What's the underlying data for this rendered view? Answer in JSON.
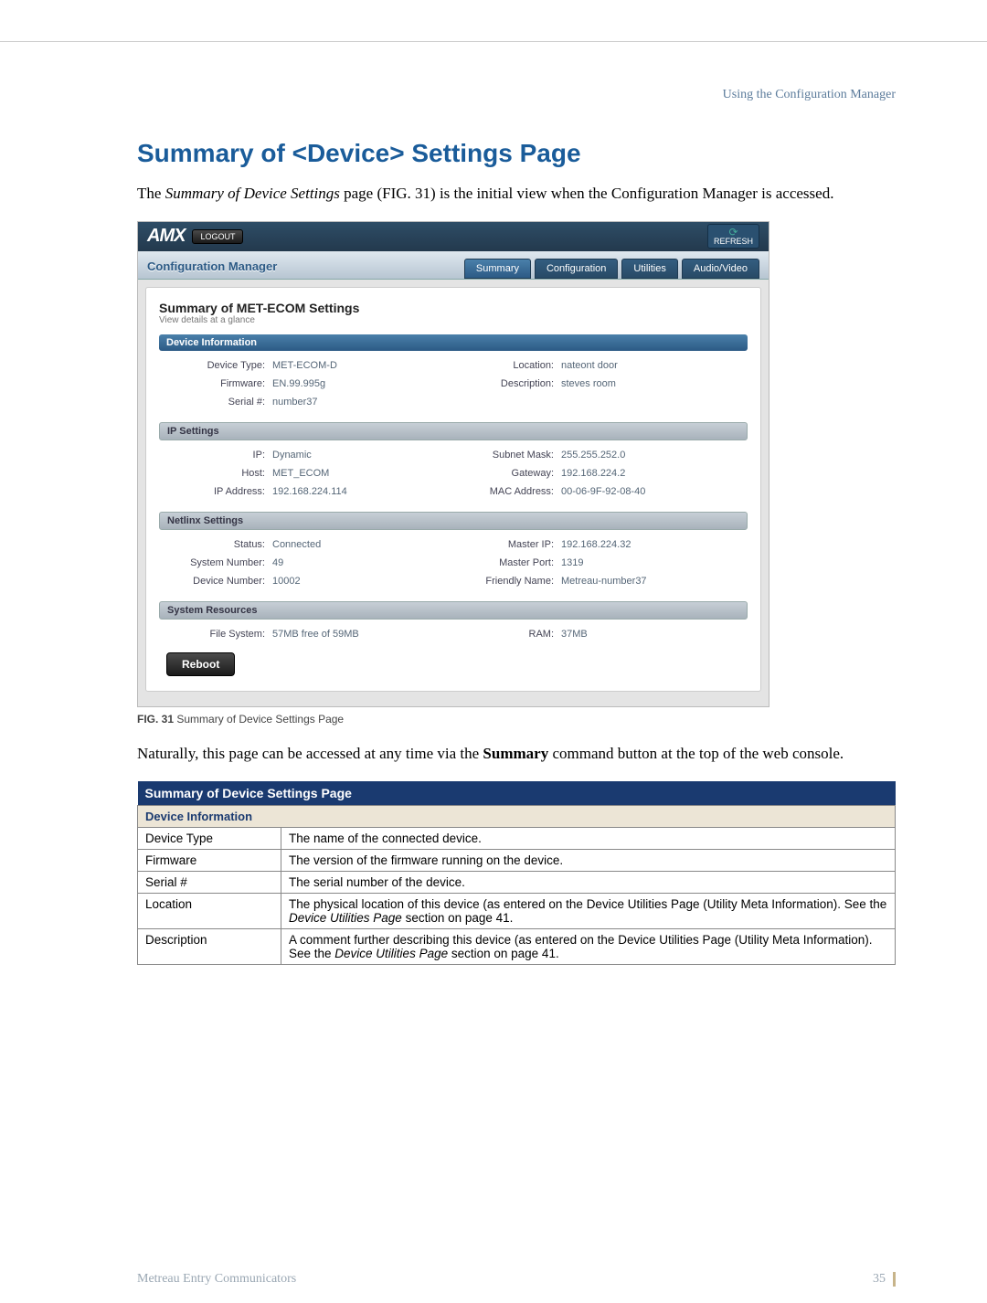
{
  "header_text": "Using the Configuration Manager",
  "section_title": "Summary of <Device> Settings Page",
  "intro_pre": "The ",
  "intro_em": "Summary of Device Settings",
  "intro_post": " page (FIG. 31) is the initial view when the Configuration Manager is accessed.",
  "shot": {
    "logo": "AMX",
    "logout": "LOGOUT",
    "refresh": "REFRESH",
    "cm_title": "Configuration Manager",
    "tabs": [
      "Summary",
      "Configuration",
      "Utilities",
      "Audio/Video"
    ],
    "heading": "Summary of MET-ECOM Settings",
    "sub": "View details at a glance",
    "sections": {
      "dev": {
        "title": "Device Information",
        "rows": [
          [
            "Device Type:",
            "MET-ECOM-D",
            "Location:",
            "nateont door"
          ],
          [
            "Firmware:",
            "EN.99.995g",
            "Description:",
            "steves room"
          ],
          [
            "Serial #:",
            "number37",
            "",
            ""
          ]
        ]
      },
      "ip": {
        "title": "IP Settings",
        "rows": [
          [
            "IP:",
            "Dynamic",
            "Subnet Mask:",
            "255.255.252.0"
          ],
          [
            "Host:",
            "MET_ECOM",
            "Gateway:",
            "192.168.224.2"
          ],
          [
            "IP Address:",
            "192.168.224.114",
            "MAC Address:",
            "00-06-9F-92-08-40"
          ]
        ]
      },
      "net": {
        "title": "Netlinx Settings",
        "rows": [
          [
            "Status:",
            "Connected",
            "Master IP:",
            "192.168.224.32"
          ],
          [
            "System Number:",
            "49",
            "Master Port:",
            "1319"
          ],
          [
            "Device Number:",
            "10002",
            "Friendly Name:",
            "Metreau-number37"
          ]
        ]
      },
      "sys": {
        "title": "System Resources",
        "rows": [
          [
            "File System:",
            "57MB free of 59MB",
            "RAM:",
            "37MB"
          ]
        ]
      }
    },
    "reboot": "Reboot"
  },
  "fig_label": "FIG. 31",
  "fig_text": "Summary of Device Settings Page",
  "para2_pre": "Naturally, this page can be accessed at any time via the ",
  "para2_strong": "Summary",
  "para2_post": " command button at the top of the web console.",
  "table": {
    "header": "Summary of Device Settings Page",
    "subheader": "Device Information",
    "rows": [
      {
        "label": "Device Type",
        "desc": "The name of the connected device."
      },
      {
        "label": "Firmware",
        "desc": "The version of the firmware running on the device."
      },
      {
        "label": "Serial #",
        "desc": "The serial number of the device."
      },
      {
        "label": "Location",
        "desc_pre": "The physical location of this device (as entered on the Device Utilities Page (Utility Meta Information). See the ",
        "desc_em": "Device Utilities Page",
        "desc_post": " section on page 41."
      },
      {
        "label": "Description",
        "desc_pre": "A comment further describing this device (as entered on the Device Utilities Page (Utility Meta Information). See the ",
        "desc_em": "Device Utilities Page",
        "desc_post": " section on page 41."
      }
    ]
  },
  "footer_left": "Metreau Entry Communicators",
  "footer_right": "35"
}
